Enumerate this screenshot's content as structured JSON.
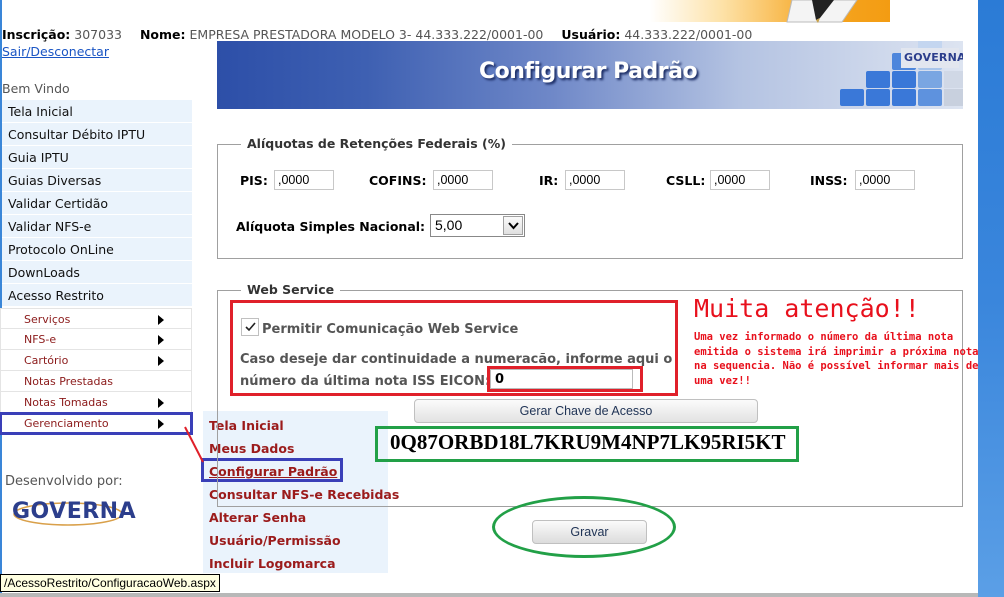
{
  "info_bar": {
    "inscricao_label": "Inscrição:",
    "inscricao_value": "307033",
    "nome_label": "Nome:",
    "nome_value": "EMPRESA PRESTADORA MODELO 3- 44.333.222/0001-00",
    "usuario_label": "Usuário:",
    "usuario_value": "44.333.222/0001-00",
    "logout_link": "Sair/Desconectar"
  },
  "sidebar": {
    "welcome": "Bem Vindo",
    "items": [
      {
        "label": "Tela Inicial"
      },
      {
        "label": "Consultar Débito IPTU"
      },
      {
        "label": "Guia IPTU"
      },
      {
        "label": "Guias Diversas"
      },
      {
        "label": "Validar Certidão"
      },
      {
        "label": "Validar NFS-e"
      },
      {
        "label": "Protocolo OnLine"
      },
      {
        "label": "DownLoads"
      },
      {
        "label": "Acesso Restrito"
      }
    ],
    "sub_items": [
      {
        "label": "Serviços",
        "has_submenu": true
      },
      {
        "label": "NFS-e",
        "has_submenu": true
      },
      {
        "label": "Cartório",
        "has_submenu": true
      },
      {
        "label": "Notas Prestadas",
        "has_submenu": false
      },
      {
        "label": "Notas Tomadas",
        "has_submenu": true
      },
      {
        "label": "Gerenciamento",
        "has_submenu": true
      }
    ],
    "developed_by": "Desenvolvido por:",
    "developer_logo": "GOVERNA"
  },
  "flyout": {
    "items": [
      {
        "label": "Tela Inicial"
      },
      {
        "label": "Meus Dados"
      },
      {
        "label": "Configurar Padrão"
      },
      {
        "label": "Consultar NFS-e Recebidas"
      },
      {
        "label": "Alterar Senha"
      },
      {
        "label": "Usuário/Permissão"
      },
      {
        "label": "Incluir Logomarca"
      }
    ],
    "current": "Configurar Padrão"
  },
  "header": {
    "title": "Configurar Padrão",
    "brand": "GOVERNA"
  },
  "retencoes": {
    "legend": "Alíquotas de Retenções Federais (%)",
    "fields": [
      {
        "label": "PIS:",
        "value": ",0000"
      },
      {
        "label": "COFINS:",
        "value": ",0000"
      },
      {
        "label": "IR:",
        "value": ",0000"
      },
      {
        "label": "CSLL:",
        "value": ",0000"
      },
      {
        "label": "INSS:",
        "value": ",0000"
      }
    ],
    "simples_label": "Alíquota Simples Nacional:",
    "simples_value": "5,00"
  },
  "webservice": {
    "legend": "Web Service",
    "checkbox_label": "Permitir Comunicação Web Service",
    "checkbox_checked": true,
    "continuity_text_1": "Caso deseje dar continuidade a numeracão, informe aqui o",
    "continuity_text_2": "número da última nota ISS EICON:",
    "last_note_value": "0",
    "warning_title": "Muita atenção!!",
    "warning_text": "Uma vez informado o número da última nota emitida o sistema irá imprimir a próxima nota na sequencia. Não é possível informar mais de uma vez!!",
    "generate_key_button": "Gerar Chave de Acesso",
    "access_key": "0Q87ORBD18L7KRU9M4NP7LK95RI5KT"
  },
  "save_button": "Gravar",
  "status_url": "/AcessoRestrito/ConfiguracaoWeb.aspx",
  "colors": {
    "annotation_red": "#e0202a",
    "annotation_blue": "#3a3fb8",
    "annotation_green": "#22a047",
    "menu_bg": "#eaf3fc",
    "submenu_text": "#8b1a1a"
  }
}
